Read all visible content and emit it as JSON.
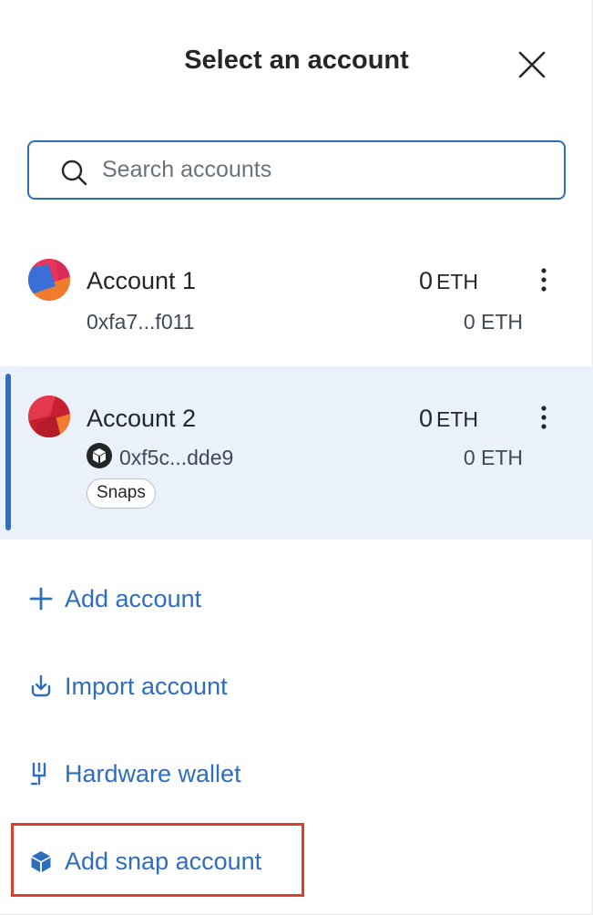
{
  "header": {
    "title": "Select an account"
  },
  "search": {
    "placeholder": "Search accounts",
    "value": ""
  },
  "accounts": [
    {
      "name": "Account 1",
      "balance": "0",
      "balance_unit": "ETH",
      "address": "0xfa7...f011",
      "fiat": "0 ETH",
      "selected": false
    },
    {
      "name": "Account 2",
      "balance": "0",
      "balance_unit": "ETH",
      "address": "0xf5c...dde9",
      "fiat": "0 ETH",
      "tag": "Snaps",
      "selected": true
    }
  ],
  "actions": [
    {
      "label": "Add account",
      "icon": "plus-icon"
    },
    {
      "label": "Import account",
      "icon": "import-icon"
    },
    {
      "label": "Hardware wallet",
      "icon": "hardware-wallet-icon"
    },
    {
      "label": "Add snap account",
      "icon": "snap-icon"
    }
  ],
  "colors": {
    "accent": "#2f6ebd",
    "selected_bg": "#eaf1fa",
    "highlight": "#d9402e"
  }
}
